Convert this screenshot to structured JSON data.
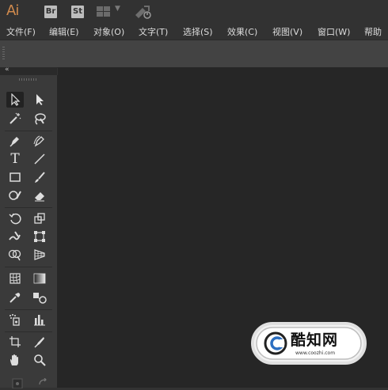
{
  "app": {
    "logo": "Ai",
    "bridge_label": "Br",
    "stock_label": "St"
  },
  "menu": [
    "文件(F)",
    "编辑(E)",
    "对象(O)",
    "文字(T)",
    "选择(S)",
    "效果(C)",
    "视图(V)",
    "窗口(W)",
    "帮助"
  ],
  "tools": {
    "type_label": "T"
  },
  "watermark": {
    "brand": "酷知网",
    "url": "www.coozhi.com"
  },
  "colors": {
    "logo": "#d08a4d",
    "canvas": "#262626",
    "chrome": "#323232",
    "toolbar": "#3a3a3a"
  }
}
